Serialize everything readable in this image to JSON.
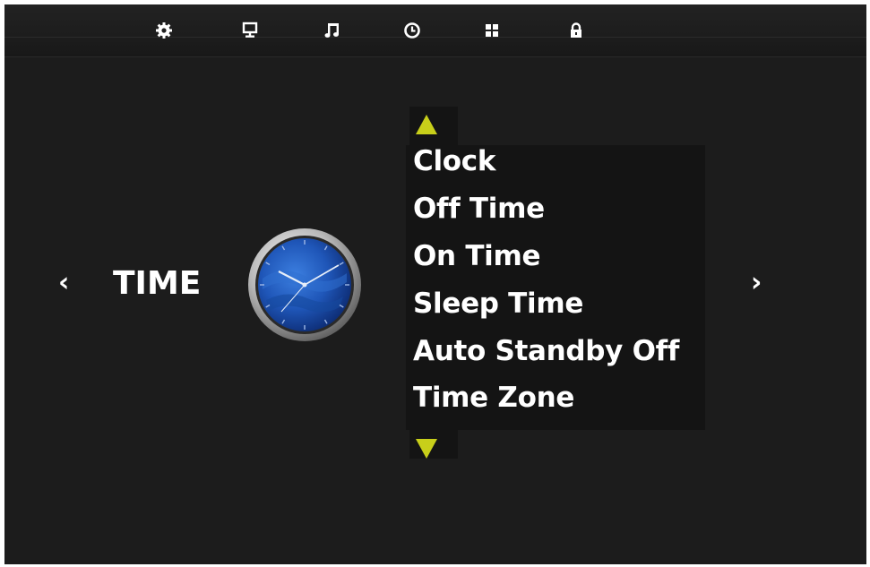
{
  "topbar": {
    "icons": [
      "gear-icon",
      "monitor-icon",
      "music-note-icon",
      "clock-icon",
      "apps-grid-icon",
      "lock-icon"
    ]
  },
  "main": {
    "title": "TIME",
    "nav_prev": "‹",
    "nav_next": "›",
    "menu_items": [
      "Clock",
      "Off Time",
      "On Time",
      "Sleep Time",
      "Auto Standby Off",
      "Time Zone"
    ]
  },
  "colors": {
    "background": "#1c1c1c",
    "accent": "#c8cf1a",
    "text": "#ffffff",
    "clock_face": "#1f56b8"
  }
}
